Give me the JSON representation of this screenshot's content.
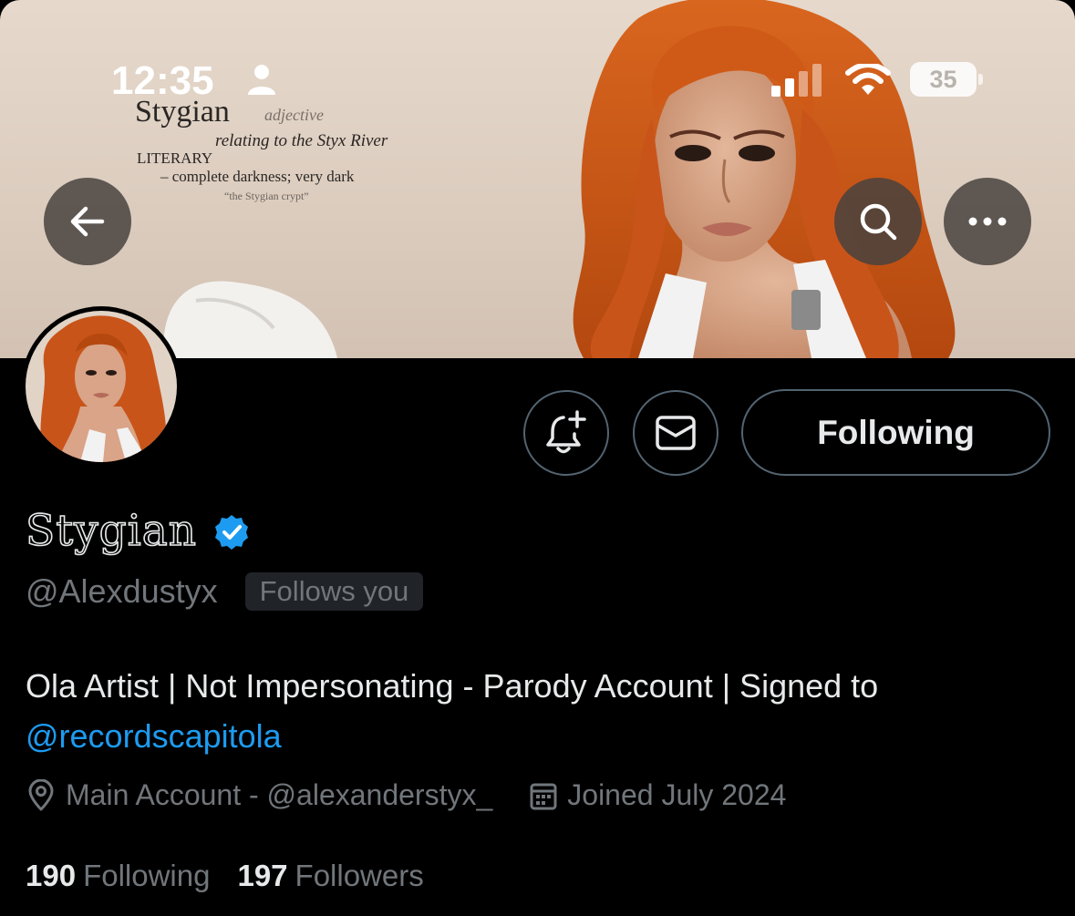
{
  "status_bar": {
    "time": "12:35",
    "battery_level": "35"
  },
  "banner": {
    "definition": {
      "word": "Stygian",
      "part_of_speech": "adjective",
      "line1": "relating to the Styx River",
      "register": "LITERARY",
      "line2": "– complete darkness; very dark",
      "example": "“the Stygian crypt”"
    }
  },
  "actions": {
    "following_label": "Following"
  },
  "profile": {
    "display_name": "Stygian",
    "handle": "@Alexdustyx",
    "follows_you_label": "Follows you",
    "bio_text": "Ola Artist | Not Impersonating - Parody Account | Signed to ",
    "bio_link": "@recordscapitola",
    "location": "Main Account - @alexanderstyx_",
    "joined": "Joined July 2024",
    "following_count": "190",
    "following_label": "Following",
    "followers_count": "197",
    "followers_label": "Followers"
  },
  "colors": {
    "background": "#000000",
    "primary_text": "#e7e9ea",
    "secondary_text": "#71767b",
    "link": "#1d9bf0",
    "verified": "#1d9bf0",
    "button_border": "#536471"
  },
  "icons": [
    "back-arrow-icon",
    "search-icon",
    "more-icon",
    "notification-bell-plus-icon",
    "mail-icon",
    "verified-badge-icon",
    "location-pin-icon",
    "calendar-icon",
    "person-icon",
    "signal-icon",
    "wifi-icon",
    "battery-icon"
  ]
}
